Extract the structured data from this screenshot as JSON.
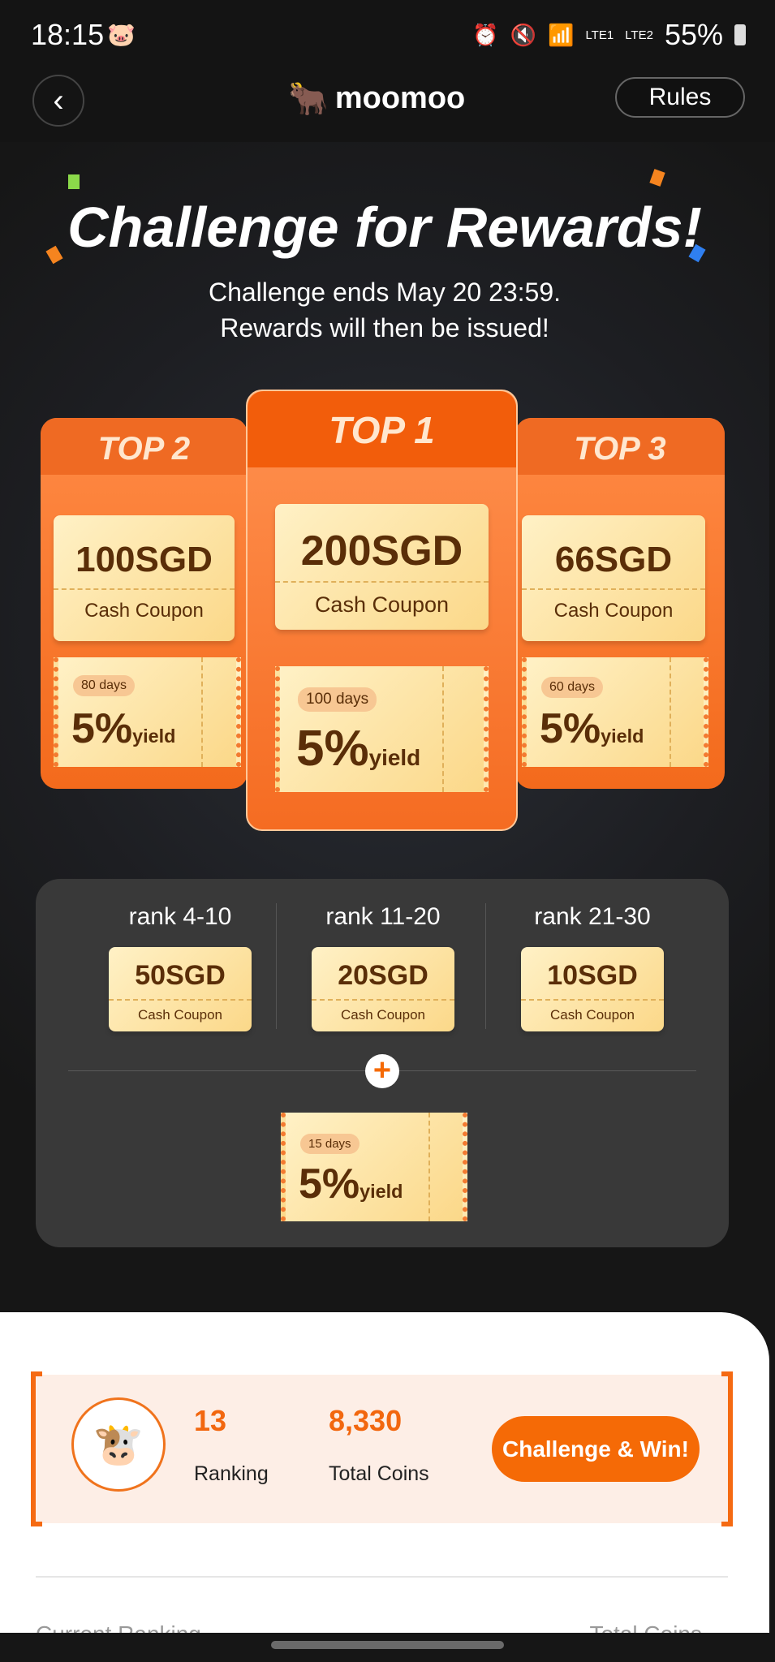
{
  "status": {
    "time": "18:15",
    "battery": "55%",
    "icons": [
      "piggy-bank-icon",
      "alarm-icon",
      "mute-icon",
      "wifi-icon",
      "volte1-signal-icon",
      "volte2-signal-icon",
      "battery-icon"
    ],
    "lte1": "LTE1",
    "lte2": "LTE2"
  },
  "nav": {
    "brand": "moomoo",
    "rules": "Rules"
  },
  "hero": {
    "title": "Challenge for Rewards!",
    "sub1": "Challenge ends May 20 23:59.",
    "sub2": "Rewards will then be issued!"
  },
  "podium": [
    {
      "label": "TOP 2",
      "amount": "100SGD",
      "coupon": "Cash Coupon",
      "days": "80 days",
      "pct": "5%",
      "yield": "yield"
    },
    {
      "label": "TOP 1",
      "amount": "200SGD",
      "coupon": "Cash Coupon",
      "days": "100 days",
      "pct": "5%",
      "yield": "yield"
    },
    {
      "label": "TOP 3",
      "amount": "66SGD",
      "coupon": "Cash Coupon",
      "days": "60 days",
      "pct": "5%",
      "yield": "yield"
    }
  ],
  "ranks": [
    {
      "label": "rank 4-10",
      "amount": "50SGD",
      "coupon": "Cash Coupon"
    },
    {
      "label": "rank 11-20",
      "amount": "20SGD",
      "coupon": "Cash Coupon"
    },
    {
      "label": "rank 21-30",
      "amount": "10SGD",
      "coupon": "Cash Coupon"
    }
  ],
  "bonus": {
    "days": "15 days",
    "pct": "5%",
    "yield": "yield"
  },
  "me": {
    "ranking": "13",
    "ranking_label": "Ranking",
    "coins": "8,330",
    "coins_label": "Total Coins",
    "cta": "Challenge & Win!"
  },
  "list_header": {
    "left": "Current Ranking",
    "right": "Total Coins"
  },
  "colors": {
    "accent": "#f56a06",
    "coupon": "#fbd889",
    "panel": "#393939"
  }
}
